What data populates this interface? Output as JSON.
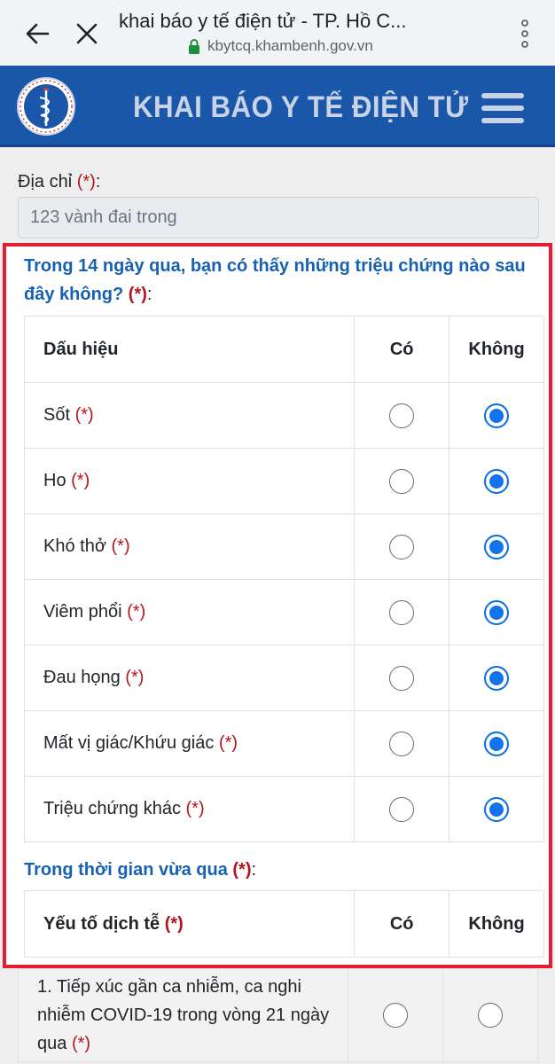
{
  "browser": {
    "title": "khai báo y tế điện tử - TP. Hồ C...",
    "url": "kbytcq.khambenh.gov.vn",
    "icons": [
      "back-arrow-icon",
      "close-icon",
      "lock-icon",
      "more-vert-icon"
    ]
  },
  "header": {
    "title": "KHAI BÁO Y TẾ ĐIỆN TỬ",
    "brand_color": "#1a57a8"
  },
  "address": {
    "label": "Địa chỉ ",
    "required": "(*)",
    "colon": ":",
    "value": "123 vành đai trong"
  },
  "symptoms": {
    "question": "Trong 14 ngày qua, bạn có thấy những triệu chứng nào sau đây không? ",
    "required": "(*)",
    "colon": ":",
    "headers": {
      "sign": "Dấu hiệu",
      "yes": "Có",
      "no": "Không"
    },
    "rows": [
      {
        "label": "Sốt ",
        "required": "(*)",
        "answer": "Không"
      },
      {
        "label": "Ho ",
        "required": "(*)",
        "answer": "Không"
      },
      {
        "label": "Khó thở ",
        "required": "(*)",
        "answer": "Không"
      },
      {
        "label": "Viêm phổi ",
        "required": "(*)",
        "answer": "Không"
      },
      {
        "label": "Đau họng ",
        "required": "(*)",
        "answer": "Không"
      },
      {
        "label": "Mất vị giác/Khứu giác ",
        "required": "(*)",
        "answer": "Không"
      },
      {
        "label": "Triệu chứng khác ",
        "required": "(*)",
        "answer": "Không"
      }
    ]
  },
  "epidemiology": {
    "question": "Trong thời gian vừa qua ",
    "required": "(*)",
    "colon": ":",
    "headers": {
      "factor": "Yếu tố dịch tễ ",
      "factor_required": "(*)",
      "yes": "Có",
      "no": "Không"
    },
    "rows": [
      {
        "label": "1. Tiếp xúc gần ca nhiễm, ca nghi nhiễm COVID-19 trong vòng 21 ngày qua ",
        "required": "(*)",
        "answer": ""
      }
    ]
  },
  "colors": {
    "required_red": "#b3151d",
    "question_blue": "#1761b0",
    "highlight_border": "#e31e32",
    "radio_checked": "#1174ea"
  }
}
